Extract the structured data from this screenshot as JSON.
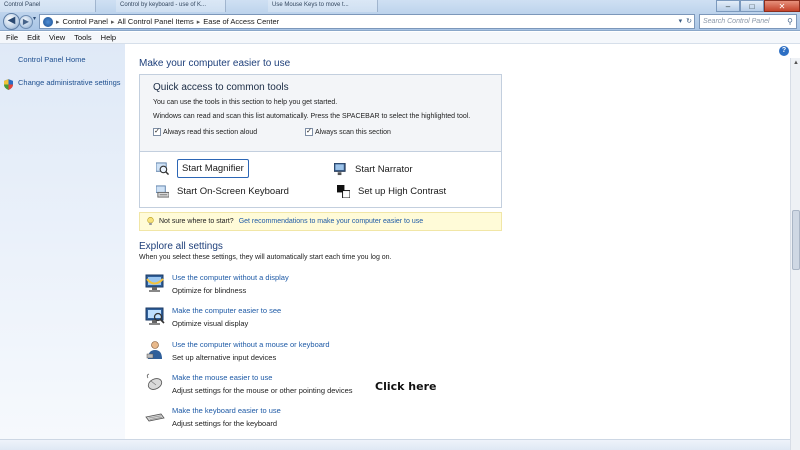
{
  "window": {
    "tabs": [
      "Control Panel",
      "Control by keyboard - use of K...",
      "Use Mouse Keys to move t..."
    ],
    "controls": {
      "minimize": "–",
      "maximize": "□",
      "close": "✕"
    }
  },
  "address": {
    "breadcrumbs": [
      "Control Panel",
      "All Control Panel Items",
      "Ease of Access Center"
    ],
    "separator": "▸",
    "search_placeholder": "Search Control Panel"
  },
  "menu": [
    "File",
    "Edit",
    "View",
    "Tools",
    "Help"
  ],
  "sidebar": {
    "home": "Control Panel Home",
    "admin": "Change administrative settings"
  },
  "main": {
    "heading": "Make your computer easier to use",
    "quick_access": {
      "title": "Quick access to common tools",
      "line1": "You can use the tools in this section to help you get started.",
      "line2": "Windows can read and scan this list automatically.  Press the SPACEBAR to select the highlighted tool.",
      "checkbox_read": "Always read this section aloud",
      "checkbox_scan": "Always scan this section",
      "checkbox_read_checked": true,
      "checkbox_scan_checked": true,
      "tools": {
        "magnifier": "Start Magnifier",
        "narrator": "Start Narrator",
        "keyboard": "Start On-Screen Keyboard",
        "contrast": "Set up High Contrast"
      }
    },
    "tip": {
      "text": "Not sure where to start?",
      "link": "Get recommendations to make your computer easier to use"
    },
    "explore": {
      "heading": "Explore all settings",
      "description": "When you select these settings, they will automatically start each time you log on.",
      "items": [
        {
          "link": "Use the computer without a display",
          "desc": "Optimize for blindness",
          "icon": "monitor-blind-icon"
        },
        {
          "link": "Make the computer easier to see",
          "desc": "Optimize visual display",
          "icon": "monitor-see-icon"
        },
        {
          "link": "Use the computer without a mouse or keyboard",
          "desc": "Set up alternative input devices",
          "icon": "person-input-icon"
        },
        {
          "link": "Make the mouse easier to use",
          "desc": "Adjust settings for the mouse or other pointing devices",
          "icon": "mouse-icon"
        },
        {
          "link": "Make the keyboard easier to use",
          "desc": "Adjust settings for the keyboard",
          "icon": "keyboard-icon"
        }
      ]
    },
    "annotation": "Click here"
  },
  "colors": {
    "link": "#1e5aa6",
    "heading": "#1e3f7a",
    "tip_bg": "#fffbd8",
    "focus": "#2c66b5"
  }
}
